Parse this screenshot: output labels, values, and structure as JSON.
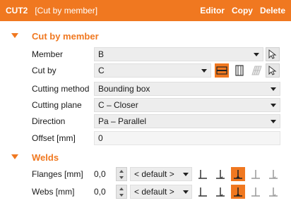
{
  "header": {
    "title": "CUT2",
    "subtitle": "[Cut by member]",
    "actions": [
      "Editor",
      "Copy",
      "Delete"
    ]
  },
  "cut_section": {
    "title": "Cut by member",
    "rows": {
      "member": {
        "label": "Member",
        "value": "B"
      },
      "cut_by": {
        "label": "Cut by",
        "value": "C"
      },
      "cutting_method": {
        "label": "Cutting method",
        "value": "Bounding box"
      },
      "cutting_plane": {
        "label": "Cutting plane",
        "value": "C – Closer"
      },
      "direction": {
        "label": "Direction",
        "value": "Pa – Parallel"
      },
      "offset": {
        "label": "Offset [mm]",
        "value": "0"
      }
    }
  },
  "welds_section": {
    "title": "Welds",
    "flanges": {
      "label": "Flanges [mm]",
      "size": "0,0",
      "type": "< default >",
      "active_weld_index": 2
    },
    "webs": {
      "label": "Webs [mm]",
      "size": "0,0",
      "type": "< default >",
      "active_weld_index": 2
    }
  },
  "colors": {
    "accent": "#f07820",
    "field": "#ededed"
  },
  "icons": [
    "pick-cursor-icon",
    "cut-type-icon",
    "weld-type-icon",
    "dropdown-arrow-icon",
    "stepper-icon"
  ]
}
